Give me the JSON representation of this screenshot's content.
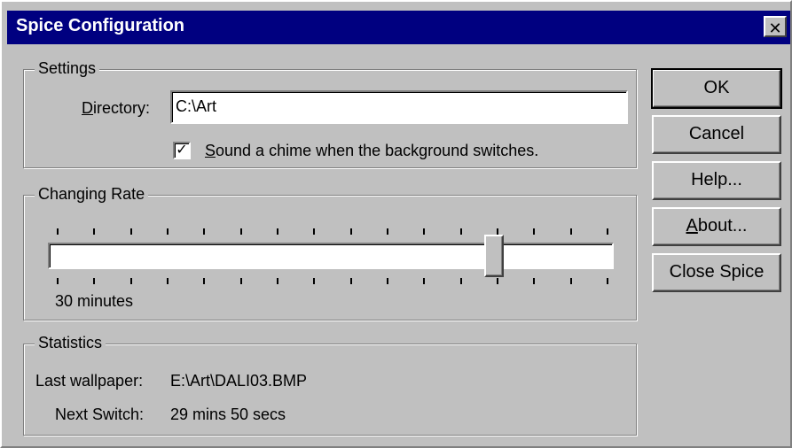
{
  "window": {
    "title": "Spice Configuration",
    "close_glyph": "✕"
  },
  "settings": {
    "group_label": "Settings",
    "directory_label_accel": "D",
    "directory_label_rest": "irectory:",
    "directory_value": "C:\\Art",
    "chime_checked": true,
    "check_glyph": "✓",
    "chime_label_accel": "S",
    "chime_label_rest": "ound a chime when the background switches."
  },
  "changing_rate": {
    "group_label": "Changing Rate",
    "value_text": "30 minutes",
    "slider_fraction": 0.8,
    "tick_count": 16
  },
  "statistics": {
    "group_label": "Statistics",
    "last_wallpaper_label": "Last wallpaper:",
    "last_wallpaper_value": "E:\\Art\\DALI03.BMP",
    "next_switch_label": "Next Switch:",
    "next_switch_value": "29 mins 50 secs"
  },
  "buttons": {
    "ok": "OK",
    "cancel": "Cancel",
    "help": "Help...",
    "about_accel": "A",
    "about_rest": "bout...",
    "close_spice": "Close Spice"
  }
}
